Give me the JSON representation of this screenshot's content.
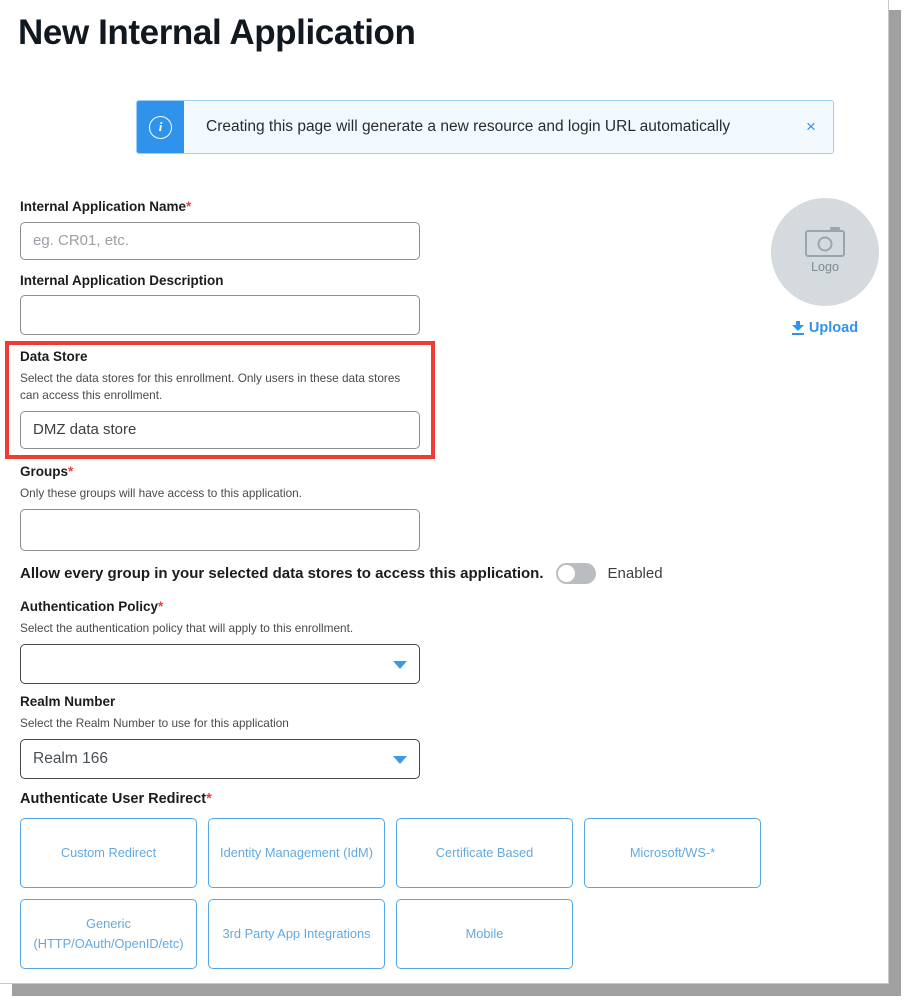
{
  "page": {
    "title": "New Internal Application"
  },
  "banner": {
    "icon": "info-circle-icon",
    "message": "Creating this page will generate a new resource and login URL automatically",
    "close_label": "×",
    "accent_color": "#2f93ec",
    "background_color": "#f2faff"
  },
  "logo": {
    "icon": "camera-icon",
    "caption": "Logo",
    "upload_label": "Upload",
    "upload_icon": "download-arrow-icon",
    "link_color": "#2f93ec"
  },
  "fields": {
    "app_name": {
      "label": "Internal Application Name",
      "required": "*",
      "placeholder": "eg. CR01, etc.",
      "value": ""
    },
    "app_description": {
      "label": "Internal Application Description",
      "required": "",
      "placeholder": "",
      "value": ""
    },
    "data_store": {
      "label": "Data Store",
      "required": "",
      "help": "Select the data stores for this enrollment. Only users in these data stores can access this enrollment.",
      "value": "DMZ data store",
      "placeholder": "",
      "highlight_color": "#ef3b34"
    },
    "groups": {
      "label": "Groups",
      "required": "*",
      "help": "Only these groups will have access to this application.",
      "value": "",
      "placeholder": ""
    },
    "allow_every_group": {
      "label": "Allow every group in your selected data stores to access this application.",
      "state_label": "Enabled",
      "checked": false
    },
    "auth_policy": {
      "label": "Authentication Policy",
      "required": "*",
      "help": "Select the authentication policy that will apply to this enrollment.",
      "value": ""
    },
    "realm_number": {
      "label": "Realm Number",
      "required": "",
      "help": "Select the Realm Number to use for this application",
      "value": "Realm 166"
    }
  },
  "redirect": {
    "title": "Authenticate User Redirect",
    "required": "*",
    "cards": [
      {
        "label": "Custom Redirect"
      },
      {
        "label": "Identity Management (IdM)"
      },
      {
        "label": "Certificate Based"
      },
      {
        "label": "Microsoft/WS-*"
      },
      {
        "label": "Generic (HTTP/OAuth/OpenID/etc)"
      },
      {
        "label": "3rd Party App Integrations"
      },
      {
        "label": "Mobile"
      }
    ]
  }
}
